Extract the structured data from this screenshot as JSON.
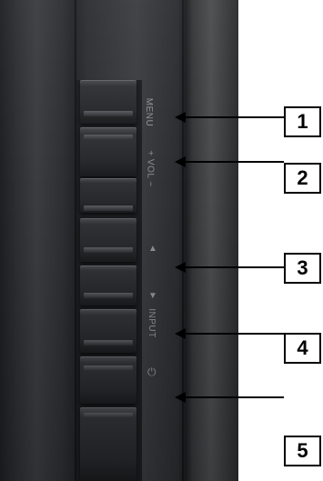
{
  "labels": {
    "menu": "MENU",
    "vol": "+ VOL −",
    "up": "▲",
    "down": "▼",
    "input": "INPUT",
    "power": "⏻"
  },
  "callouts": [
    "1",
    "2",
    "3",
    "4",
    "5"
  ]
}
